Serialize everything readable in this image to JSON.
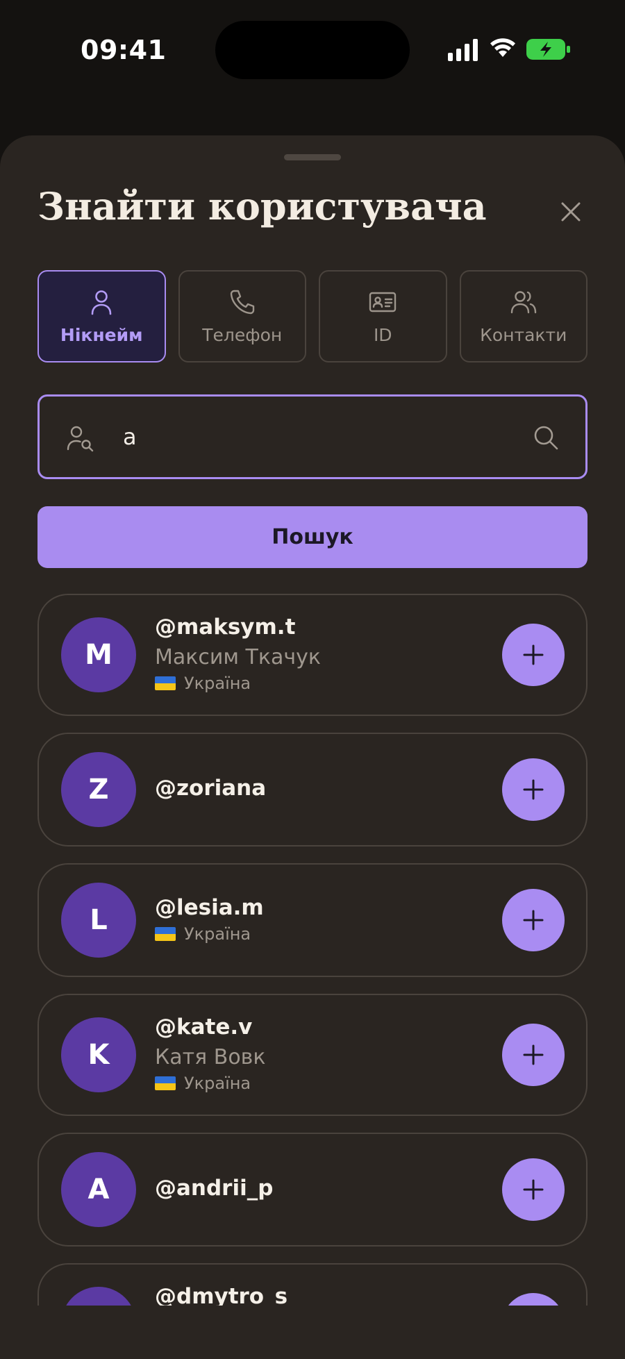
{
  "status_bar": {
    "time": "09:41",
    "icons": [
      "signal-icon",
      "wifi-icon",
      "battery-charging-icon"
    ],
    "battery_color": "#3ecf4a"
  },
  "sheet": {
    "title": "Знайти користувача",
    "close_icon": "close-icon"
  },
  "tabs": [
    {
      "label": "Нікнейм",
      "icon": "user-icon",
      "active": true
    },
    {
      "label": "Телефон",
      "icon": "phone-icon",
      "active": false
    },
    {
      "label": "ID",
      "icon": "id-card-icon",
      "active": false
    },
    {
      "label": "Контакти",
      "icon": "contacts-icon",
      "active": false
    }
  ],
  "search": {
    "value": "a",
    "left_icon": "user-search-icon",
    "right_icon": "search-icon"
  },
  "search_button": {
    "label": "Пошук"
  },
  "results": [
    {
      "initial": "M",
      "username": "@maksym.t",
      "full_name": "Максим Ткачук",
      "country": "Україна"
    },
    {
      "initial": "Z",
      "username": "@zoriana",
      "full_name": "",
      "country": ""
    },
    {
      "initial": "L",
      "username": "@lesia.m",
      "full_name": "",
      "country": "Україна"
    },
    {
      "initial": "K",
      "username": "@kate.v",
      "full_name": "Катя Вовк",
      "country": "Україна"
    },
    {
      "initial": "A",
      "username": "@andrii_p",
      "full_name": "",
      "country": ""
    },
    {
      "initial": "",
      "username": "@dmytro_s",
      "full_name": "",
      "country": ""
    }
  ],
  "colors": {
    "accent": "#a98cf2",
    "avatar": "#5b3aa3",
    "sheet_bg": "#2a2521",
    "flag_blue": "#2f6fd6",
    "flag_yellow": "#f5c518"
  }
}
